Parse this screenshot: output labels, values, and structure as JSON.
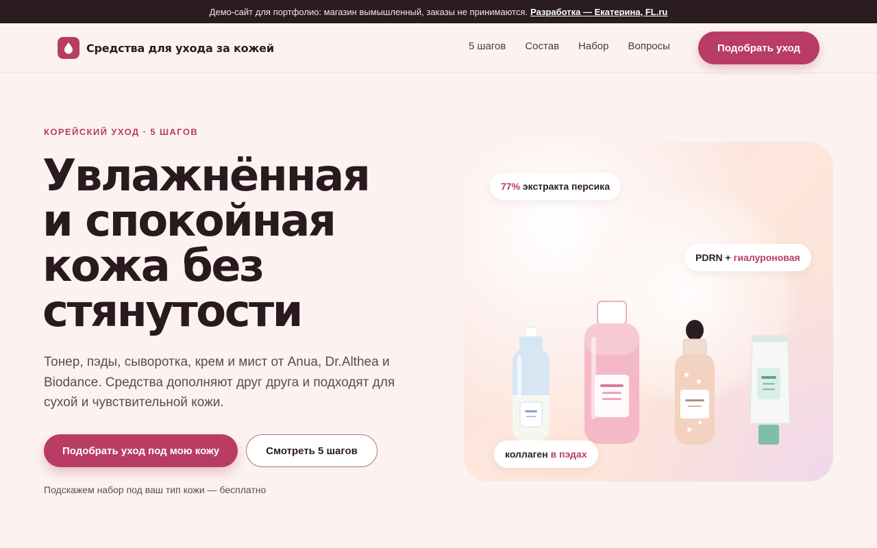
{
  "announcement": {
    "text": "Демо-сайт для портфолио: магазин вымышленный, заказы не принимаются.",
    "link": "Разработка — Екатерина, FL.ru"
  },
  "header": {
    "logo_text": "Средства для ухода за кожей",
    "nav": [
      "5 шагов",
      "Состав",
      "Набор",
      "Вопросы"
    ],
    "cta": "Подобрать уход"
  },
  "hero": {
    "eyebrow": "КОРЕЙСКИЙ УХОД · 5 ШАГОВ",
    "title_lines": [
      "Увлажнённая",
      "и спокойная",
      "кожа без",
      "стянутости"
    ],
    "lead": "Тонер, пэды, сыворотка, крем и мист от Anua, Dr.Althea и Biodance. Средства дополняют друг друга и подходят для сухой и чувствительной кожи.",
    "primary_button": "Подобрать уход под мою кожу",
    "secondary_button": "Смотреть 5 шагов",
    "hint": "Подскажем набор под ваш тип кожи — бесплатно"
  },
  "badges": {
    "peach": {
      "accent": "77%",
      "text": " экстракта персика"
    },
    "pdrn": {
      "text": "PDRN + ",
      "accent": "гиалуроновая"
    },
    "collagen": {
      "text": "коллаген ",
      "accent": "в пэдах"
    }
  },
  "colors": {
    "accent": "#b83c63",
    "dark": "#2b1c21",
    "background": "#fcf3f0"
  },
  "icons": {
    "logo": "droplet-icon"
  }
}
